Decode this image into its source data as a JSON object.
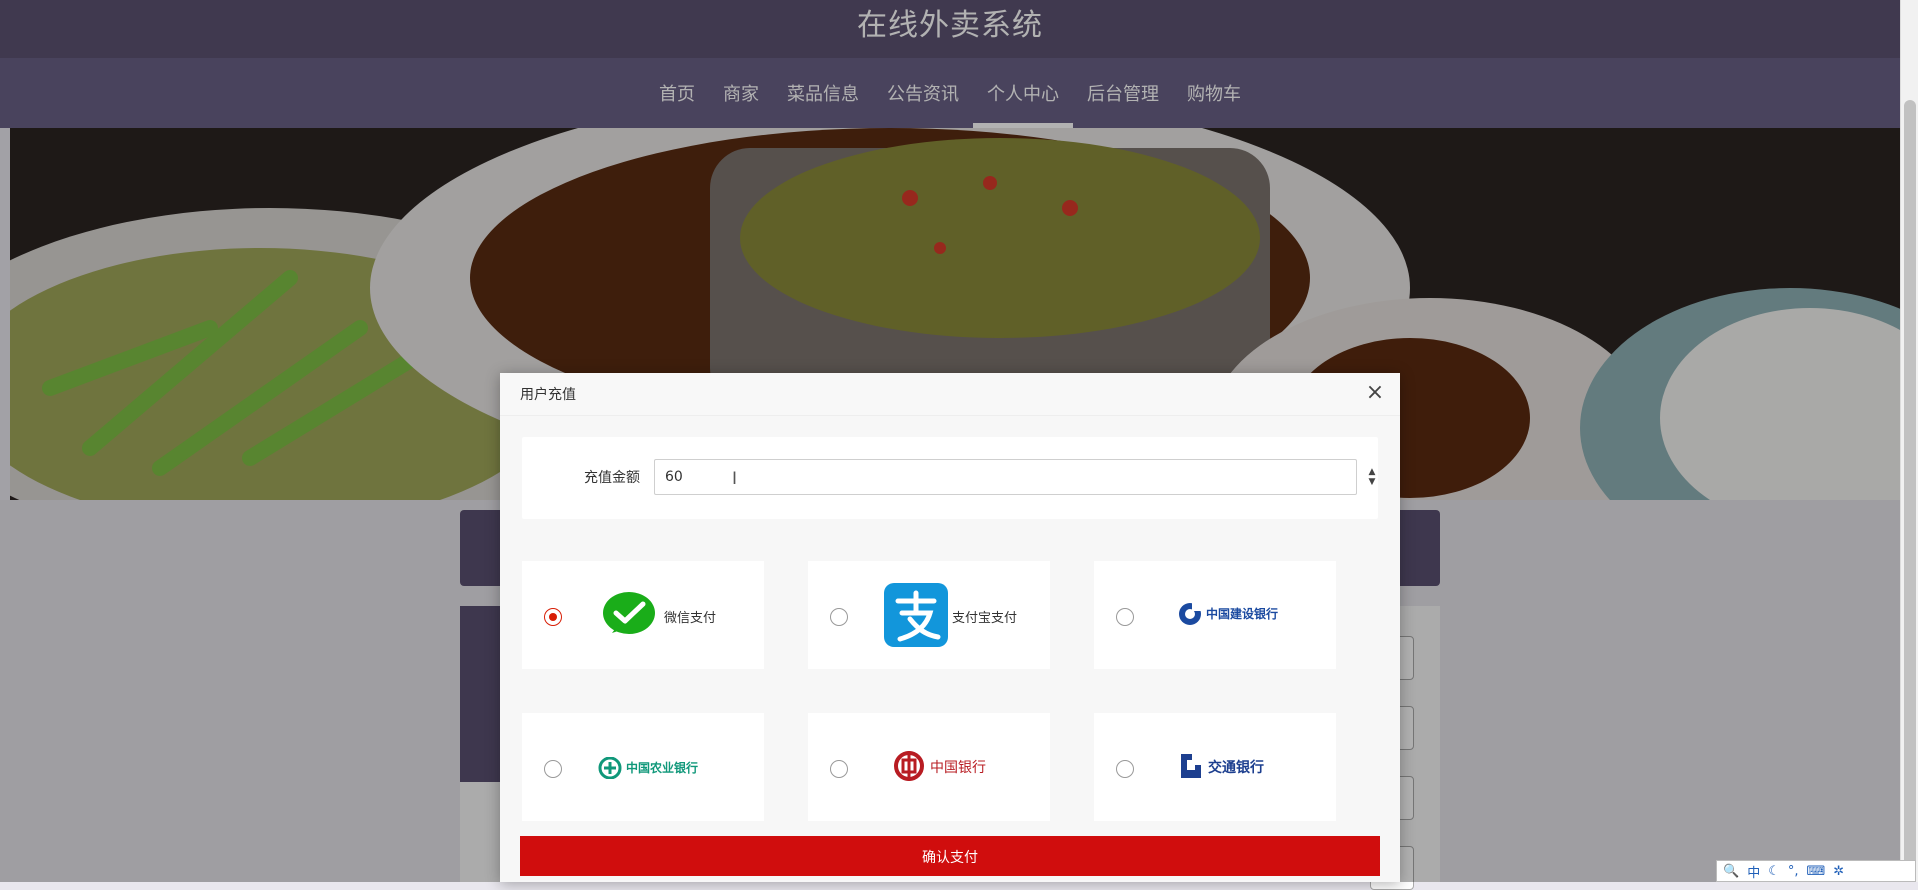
{
  "header": {
    "title": "在线外卖系统"
  },
  "nav": {
    "items": [
      {
        "label": "首页",
        "active": false
      },
      {
        "label": "商家",
        "active": false
      },
      {
        "label": "菜品信息",
        "active": false
      },
      {
        "label": "公告资讯",
        "active": false
      },
      {
        "label": "个人中心",
        "active": true
      },
      {
        "label": "后台管理",
        "active": false
      },
      {
        "label": "购物车",
        "active": false
      }
    ]
  },
  "banner": {
    "image": "food-banner"
  },
  "modal": {
    "title": "用户充值",
    "close_icon": "×",
    "amount_label": "充值金额",
    "amount_value": "60",
    "payment_options": [
      {
        "name": "wechat-pay",
        "label": "微信支付",
        "selected": true
      },
      {
        "name": "alipay",
        "label": "支付宝支付",
        "selected": false
      },
      {
        "name": "ccb",
        "logo_text": "中国建设银行",
        "selected": false
      },
      {
        "name": "abc",
        "logo_text": "中国农业银行",
        "selected": false
      },
      {
        "name": "boc",
        "logo_text": "中国银行",
        "selected": false
      },
      {
        "name": "bocom",
        "logo_text": "交通银行",
        "selected": false
      }
    ],
    "submit_label": "确认支付"
  },
  "ime": {
    "mode": "中"
  },
  "colors": {
    "header": "#5c5272",
    "nav": "#696086",
    "accent": "#d00d0d",
    "wechat": "#1aad19",
    "alipay": "#1296db"
  }
}
